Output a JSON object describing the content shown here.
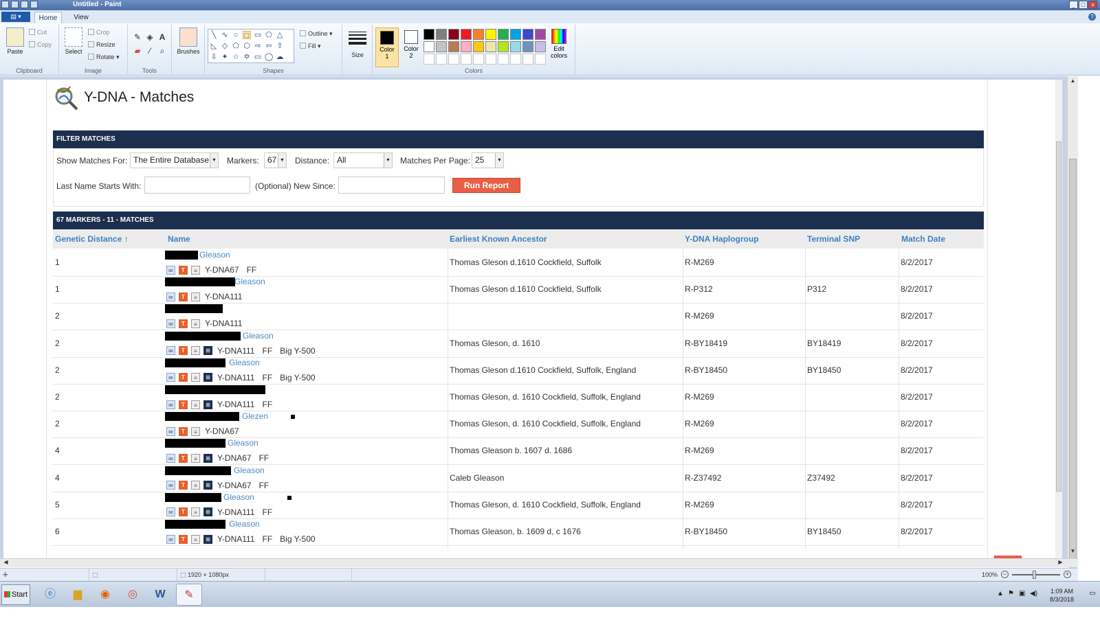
{
  "window": {
    "title": "Untitled - Paint"
  },
  "ribbon": {
    "tabs": [
      "Home",
      "View"
    ],
    "clipboard": {
      "paste": "Paste",
      "cut": "Cut",
      "copy": "Copy",
      "label": "Clipboard"
    },
    "image": {
      "select": "Select",
      "crop": "Crop",
      "resize": "Resize",
      "rotate": "Rotate",
      "label": "Image"
    },
    "tools": {
      "label": "Tools"
    },
    "brushes": "Brushes",
    "shapes": {
      "outline": "Outline",
      "fill": "Fill",
      "label": "Shapes"
    },
    "size": "Size",
    "color1_line1": "Color",
    "color1_line2": "1",
    "color2_line1": "Color",
    "color2_line2": "2",
    "colors_label": "Colors",
    "edit_line1": "Edit",
    "edit_line2": "colors",
    "palette": [
      "#000000",
      "#7f7f7f",
      "#880015",
      "#ed1c24",
      "#ff7f27",
      "#fff200",
      "#22b14c",
      "#00a2e8",
      "#3f48cc",
      "#a349a4",
      "#ffffff",
      "#c3c3c3",
      "#b97a57",
      "#ffaec9",
      "#ffc90e",
      "#efe4b0",
      "#b5e61d",
      "#99d9ea",
      "#7092be",
      "#c8bfe7",
      "#ffffff",
      "#ffffff",
      "#ffffff",
      "#ffffff",
      "#ffffff",
      "#ffffff",
      "#ffffff",
      "#ffffff",
      "#ffffff",
      "#ffffff"
    ]
  },
  "page": {
    "title": "Y-DNA - Matches",
    "filter_bar": "FILTER MATCHES",
    "show_matches_label": "Show Matches For:",
    "show_matches_value": "The Entire Database",
    "markers_label": "Markers:",
    "markers_value": "67",
    "distance_label": "Distance:",
    "distance_value": "All",
    "per_page_label": "Matches Per Page:",
    "per_page_value": "25",
    "lastname_label": "Last Name Starts With:",
    "newsince_label": "(Optional) New Since:",
    "run_button": "Run Report",
    "results_bar": "67 MARKERS - 11 - MATCHES",
    "columns": {
      "distance": "Genetic Distance",
      "sort_arrow": "↑",
      "name": "Name",
      "ancestor": "Earliest Known Ancestor",
      "haplogroup": "Y-DNA Haplogroup",
      "snp": "Terminal SNP",
      "date": "Match Date"
    },
    "rows": [
      {
        "distance": "1",
        "surname": "Gleason",
        "kit": "Y-DNA67",
        "ff": "FF",
        "bigy": "",
        "ancestor": "Thomas Gleson d.1610 Cockfield, Suffolk",
        "haplogroup": "R-M269",
        "snp": "",
        "date": "8/2/2017"
      },
      {
        "distance": "1",
        "surname": "Gleason",
        "kit": "Y-DNA111",
        "ff": "",
        "bigy": "",
        "ancestor": "Thomas Gleson d.1610 Cockfield, Suffolk",
        "haplogroup": "R-P312",
        "snp": "P312",
        "date": "8/2/2017"
      },
      {
        "distance": "2",
        "surname": "",
        "kit": "Y-DNA111",
        "ff": "",
        "bigy": "",
        "ancestor": "",
        "haplogroup": "R-M269",
        "snp": "",
        "date": "8/2/2017"
      },
      {
        "distance": "2",
        "surname": "Gleason",
        "kit": "Y-DNA111",
        "ff": "FF",
        "bigy": "Big Y-500",
        "ancestor": "Thomas Gleson, d. 1610",
        "haplogroup": "R-BY18419",
        "snp": "BY18419",
        "date": "8/2/2017"
      },
      {
        "distance": "2",
        "surname": "Gleason",
        "kit": "Y-DNA111",
        "ff": "FF",
        "bigy": "Big Y-500",
        "ancestor": "Thomas Gleson d.1610 Cockfield, Suffolk, England",
        "haplogroup": "R-BY18450",
        "snp": "BY18450",
        "date": "8/2/2017"
      },
      {
        "distance": "2",
        "surname": "",
        "kit": "Y-DNA111",
        "ff": "FF",
        "bigy": "",
        "ancestor": "Thomas Gleson, d. 1610 Cockfield, Suffolk, England",
        "haplogroup": "R-M269",
        "snp": "",
        "date": "8/2/2017"
      },
      {
        "distance": "2",
        "surname": "Glezen",
        "kit": "Y-DNA67",
        "ff": "",
        "bigy": "",
        "ancestor": "Thomas Gleson, d. 1610 Cockfield, Suffolk, England",
        "haplogroup": "R-M269",
        "snp": "",
        "date": "8/2/2017"
      },
      {
        "distance": "4",
        "surname": "Gleason",
        "kit": "Y-DNA67",
        "ff": "FF",
        "bigy": "",
        "ancestor": "Thomas Gleason b. 1607 d. 1686",
        "haplogroup": "R-M269",
        "snp": "",
        "date": "8/2/2017"
      },
      {
        "distance": "4",
        "surname": "Gleason",
        "kit": "Y-DNA67",
        "ff": "FF",
        "bigy": "",
        "ancestor": "Caleb Gleason",
        "haplogroup": "R-Z37492",
        "snp": "Z37492",
        "date": "8/2/2017"
      },
      {
        "distance": "5",
        "surname": "Gleason",
        "kit": "Y-DNA111",
        "ff": "FF",
        "bigy": "",
        "ancestor": "Thomas Gleson, d. 1610 Cockfield, Suffolk, England",
        "haplogroup": "R-M269",
        "snp": "",
        "date": "8/2/2017"
      },
      {
        "distance": "6",
        "surname": "Gleason",
        "kit": "Y-DNA111",
        "ff": "FF",
        "bigy": "Big Y-500",
        "ancestor": "Thomas Gleason, b. 1609 d, c 1676",
        "haplogroup": "R-BY18450",
        "snp": "BY18450",
        "date": "8/2/2017"
      }
    ]
  },
  "statusbar": {
    "dimensions": "1920 × 1080px",
    "zoom": "100%"
  },
  "taskbar": {
    "start": "Start",
    "time": "1:09 AM",
    "date": "8/3/2018"
  }
}
